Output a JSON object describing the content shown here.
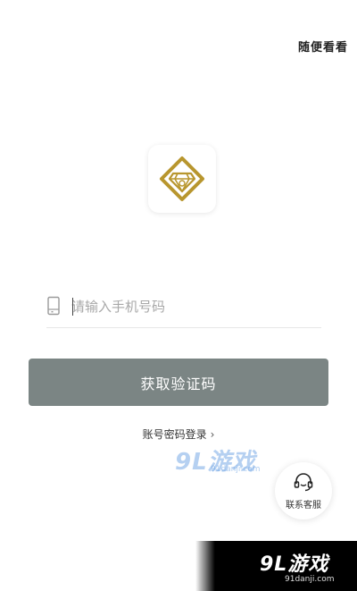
{
  "header": {
    "browse_label": "随便看看"
  },
  "logo": {
    "icon": "diamond-logo-icon",
    "color": "#b8962e"
  },
  "login": {
    "phone_placeholder": "请输入手机号码",
    "phone_value": "",
    "get_code_label": "获取验证码",
    "password_login_label": "账号密码登录",
    "button_color": "#7b8584"
  },
  "support": {
    "label": "联系客服",
    "icon": "headset-icon"
  },
  "watermark": {
    "brand": "9L游戏",
    "domain": "91danji.com"
  }
}
